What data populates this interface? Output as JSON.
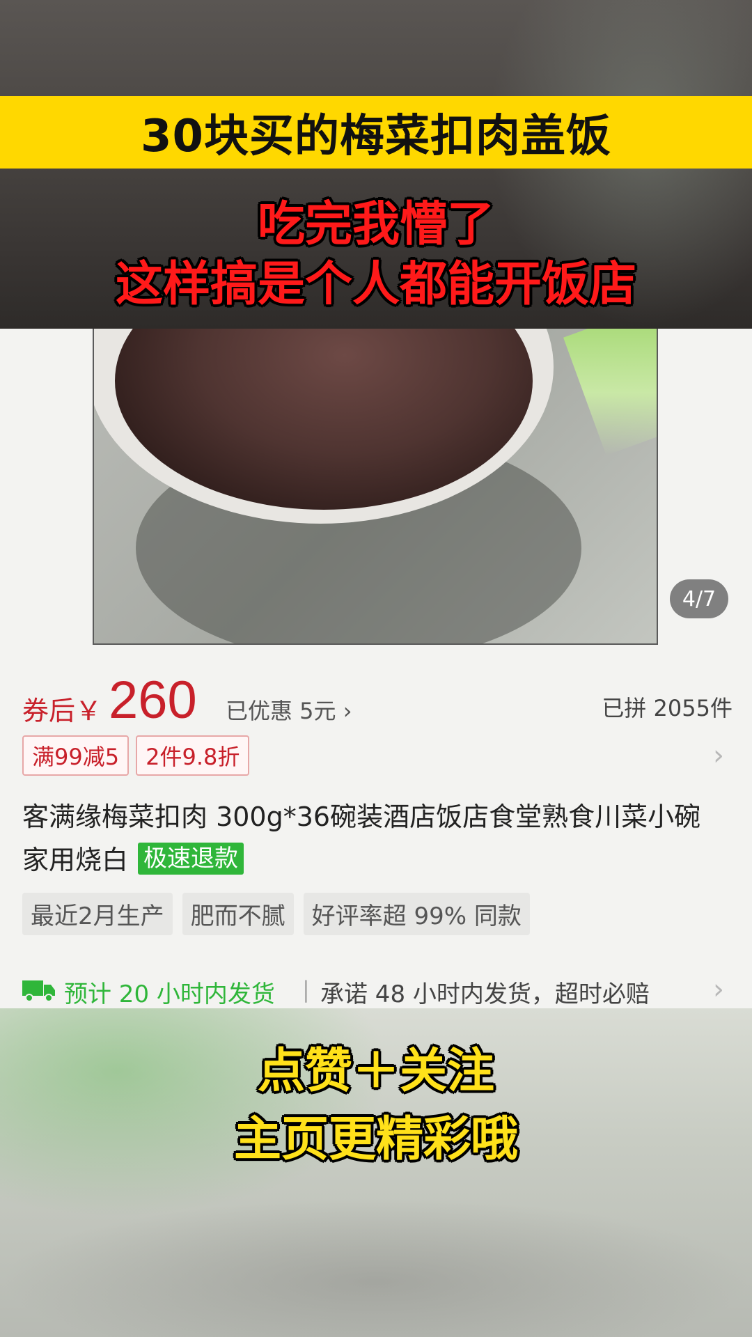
{
  "overlay": {
    "title": "30块买的梅菜扣肉盖饭",
    "red_line_1": "吃完我懵了",
    "red_line_2": "这样搞是个人都能开饭店",
    "bottom_line_1": "点赞＋关注",
    "bottom_line_2": "主页更精彩哦"
  },
  "product": {
    "image_counter": "4/7",
    "price_prefix": "券后￥",
    "price": "260",
    "discount": "已优惠 5元 ›",
    "sold": "已拼 2055件",
    "promo_tags": [
      "满99减5",
      "2件9.8折"
    ],
    "title": "客满缘梅菜扣肉 300g*36碗装酒店饭店食堂熟食川菜小碗家用烧白",
    "fast_refund": "极速退款",
    "feature_tags": [
      "最近2月生产",
      "肥而不腻",
      "好评率超 99% 同款"
    ],
    "shipping_estimate": "预计 20 小时内发货",
    "shipping_promise": "承诺 48 小时内发货，超时必赔"
  },
  "icons": [
    "chevron-right-icon",
    "truck-icon"
  ],
  "colors": {
    "title_band": "#ffd800",
    "red_text": "#ff1a1a",
    "price_red": "#c8202a",
    "green": "#2fb63a",
    "yellow_text": "#ffe11a"
  }
}
